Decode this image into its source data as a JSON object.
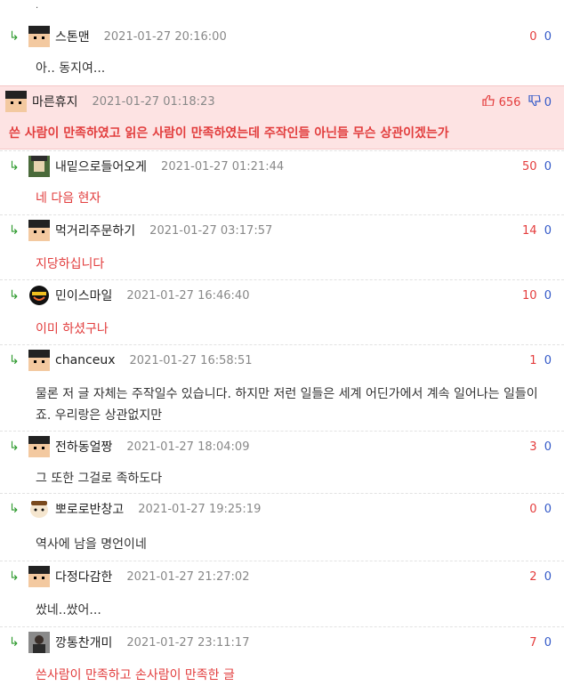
{
  "top_dot": "·",
  "best": {
    "nick": "마른휴지",
    "date": "2021-01-27 01:18:23",
    "up": "656",
    "down": "0",
    "text": "쓴 사람이 만족하였고 읽은 사람이 만족하였는데 주작인들 아닌들 무슨 상관이겠는가"
  },
  "comments": [
    {
      "nick": "스톤맨",
      "date": "2021-01-27 20:16:00",
      "up": "0",
      "down": "0",
      "text": "아.. 동지여..."
    },
    {
      "nick": "내밑으로들어오게",
      "date": "2021-01-27 01:21:44",
      "up": "50",
      "down": "0",
      "text": "네 다음 현자"
    },
    {
      "nick": "먹거리주문하기",
      "date": "2021-01-27 03:17:57",
      "up": "14",
      "down": "0",
      "text": "지당하십니다"
    },
    {
      "nick": "민이스마일",
      "date": "2021-01-27 16:46:40",
      "up": "10",
      "down": "0",
      "text": "이미 하셨구나"
    },
    {
      "nick": "chanceux",
      "date": "2021-01-27 16:58:51",
      "up": "1",
      "down": "0",
      "text": "물론 저 글 자체는 주작일수 있습니다. 하지만 저런 일들은 세계 어딘가에서 계속 일어나는 일들이죠. 우리랑은 상관없지만"
    },
    {
      "nick": "전하동얼짱",
      "date": "2021-01-27 18:04:09",
      "up": "3",
      "down": "0",
      "text": "그 또한 그걸로 족하도다"
    },
    {
      "nick": "뽀로로반창고",
      "date": "2021-01-27 19:25:19",
      "up": "0",
      "down": "0",
      "text": "역사에 남을 명언이네"
    },
    {
      "nick": "다정다감한",
      "date": "2021-01-27 21:27:02",
      "up": "2",
      "down": "0",
      "text": "쌌네..쌌어..."
    },
    {
      "nick": "깡통찬개미",
      "date": "2021-01-27 23:11:17",
      "up": "7",
      "down": "0",
      "text": "쓴사람이 만족하고 손사람이 만족한 글"
    }
  ],
  "icons": {
    "reply": "reply-arrow-icon",
    "thumb_up": "thumb-up-icon",
    "thumb_down": "thumb-down-icon"
  },
  "colors": {
    "upvote": "#e43c3c",
    "downvote": "#3359c8",
    "best_bg": "#fde3e3",
    "reply_arrow": "#2e9a2e"
  }
}
